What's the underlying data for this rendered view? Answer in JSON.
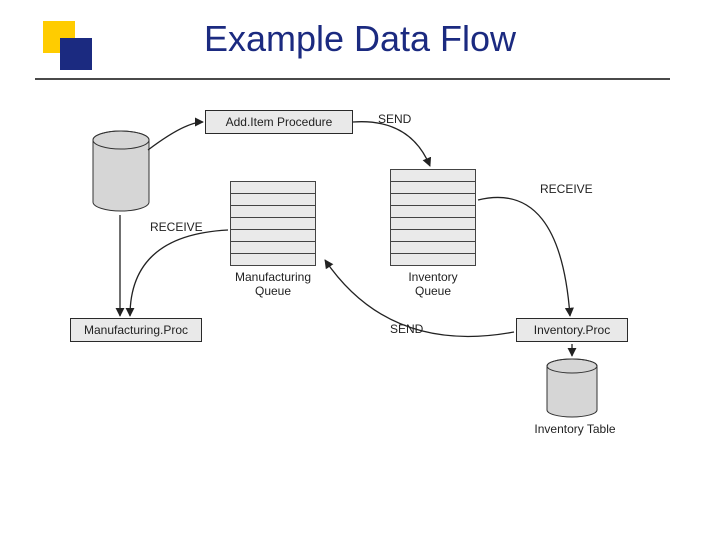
{
  "title": "Example Data Flow",
  "nodes": {
    "addItem": "Add.Item Procedure",
    "manufacturingProc": "Manufacturing.Proc",
    "inventoryProc": "Inventory.Proc",
    "manufacturingQueue": "Manufacturing\nQueue",
    "inventoryQueue": "Inventory\nQueue",
    "inventoryTable": "Inventory Table"
  },
  "edges": {
    "send1": "SEND",
    "receive1": "RECEIVE",
    "send2": "SEND",
    "receive2": "RECEIVE"
  }
}
